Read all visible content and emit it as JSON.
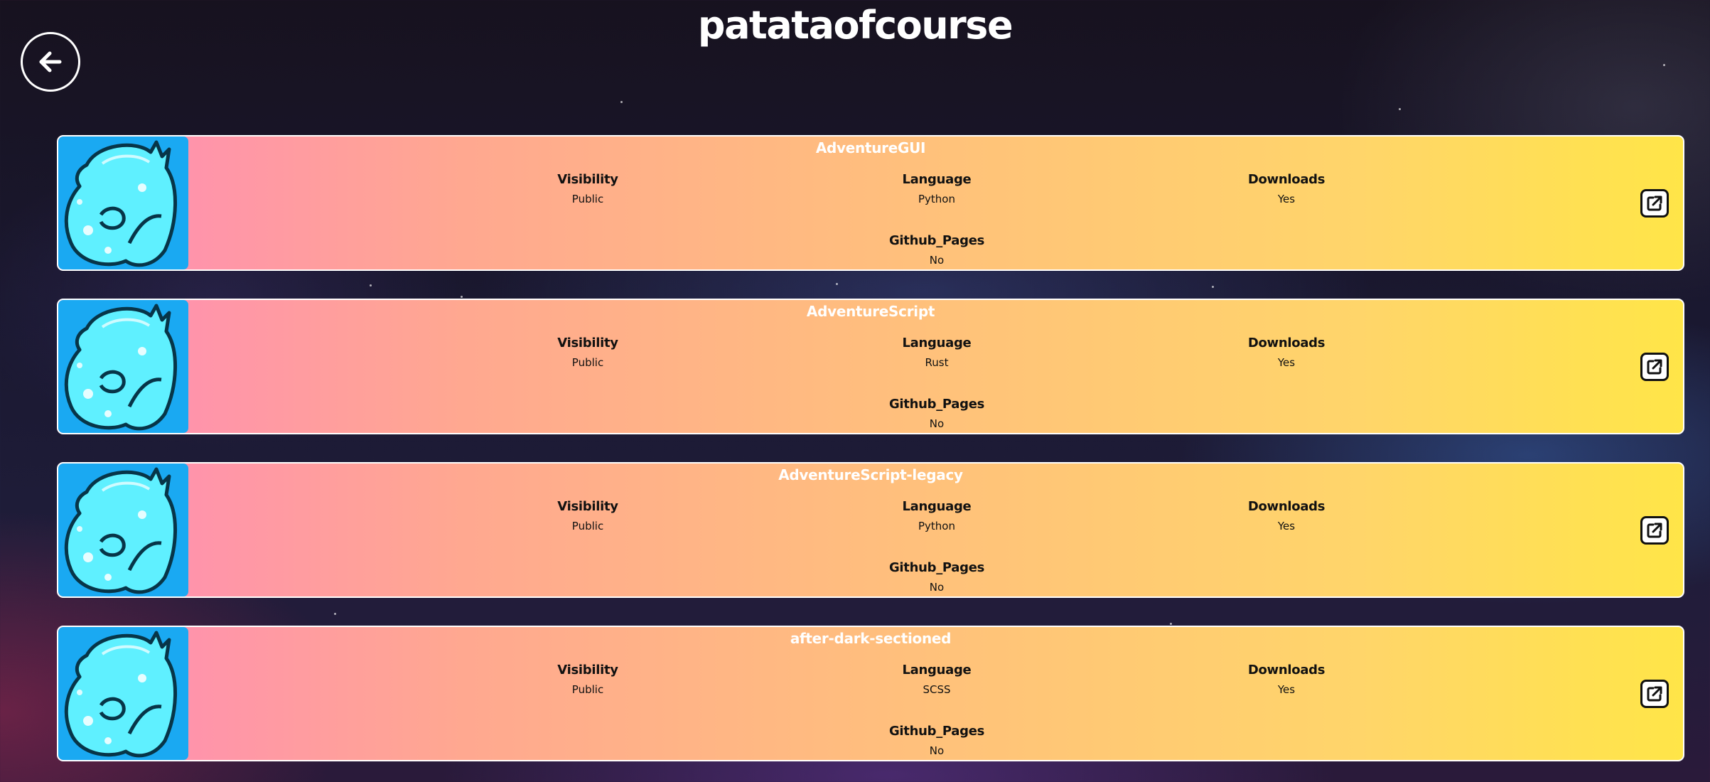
{
  "page": {
    "title": "patataofcourse"
  },
  "back_button": {
    "icon": "arrow-left-icon"
  },
  "repos": [
    {
      "name": "AdventureGUI",
      "visibility_label": "Visibility",
      "visibility": "Public",
      "language_label": "Language",
      "language": "Python",
      "downloads_label": "Downloads",
      "downloads": "Yes",
      "pages_label": "Github_Pages",
      "pages": "No"
    },
    {
      "name": "AdventureScript",
      "visibility_label": "Visibility",
      "visibility": "Public",
      "language_label": "Language",
      "language": "Rust",
      "downloads_label": "Downloads",
      "downloads": "Yes",
      "pages_label": "Github_Pages",
      "pages": "No"
    },
    {
      "name": "AdventureScript-legacy",
      "visibility_label": "Visibility",
      "visibility": "Public",
      "language_label": "Language",
      "language": "Python",
      "downloads_label": "Downloads",
      "downloads": "Yes",
      "pages_label": "Github_Pages",
      "pages": "No"
    },
    {
      "name": "after-dark-sectioned",
      "visibility_label": "Visibility",
      "visibility": "Public",
      "language_label": "Language",
      "language": "SCSS",
      "downloads_label": "Downloads",
      "downloads": "Yes",
      "pages_label": "Github_Pages",
      "pages": "No"
    }
  ],
  "colors": {
    "card_gradient_start": "#ff8ab8",
    "card_gradient_end": "#ffe548",
    "avatar_background": "#1aa9f2",
    "avatar_figure": "#5ff0ff"
  }
}
